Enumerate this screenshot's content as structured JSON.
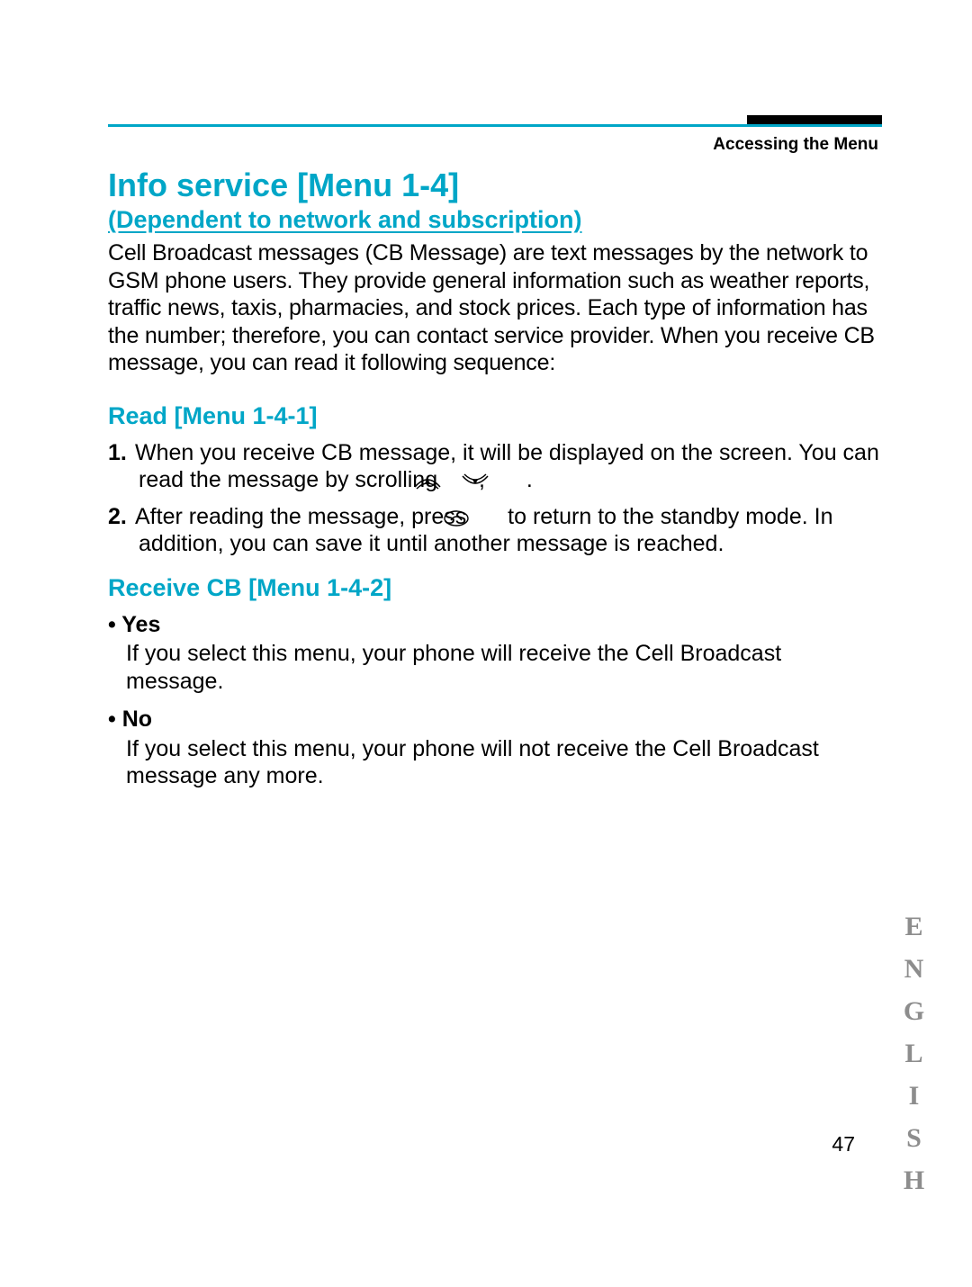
{
  "header": {
    "breadcrumb": "Accessing the Menu"
  },
  "title": "Info service [Menu 1-4]",
  "subtitle": "(Dependent to network and subscription)",
  "intro": "Cell Broadcast messages (CB Message) are text messages by the network to GSM phone users. They provide general information such as weather reports, traffic news, taxis, pharmacies, and stock prices. Each type of information has the number; therefore, you can contact service provider. When you receive CB message, you can read it following sequence:",
  "read": {
    "heading": "Read [Menu 1-4-1]",
    "items": [
      {
        "num": "1.",
        "pre": "When you receive CB message, it will be displayed on the screen.  You can read the message by scrolling ",
        "mid": " , ",
        "post": " ."
      },
      {
        "num": "2.",
        "pre": "After reading the message, press ",
        "post": " to return to the standby mode. In addition, you can save it until another message is reached."
      }
    ]
  },
  "receive": {
    "heading": "Receive CB [Menu 1-4-2]",
    "yes_label": "• Yes",
    "yes_desc": "If you select this menu, your phone will receive the Cell Broadcast message.",
    "no_label": "• No",
    "no_desc": "If you select this menu, your phone will not receive the Cell Broadcast message any more."
  },
  "page_number": "47",
  "side_label": "ENGLISH"
}
